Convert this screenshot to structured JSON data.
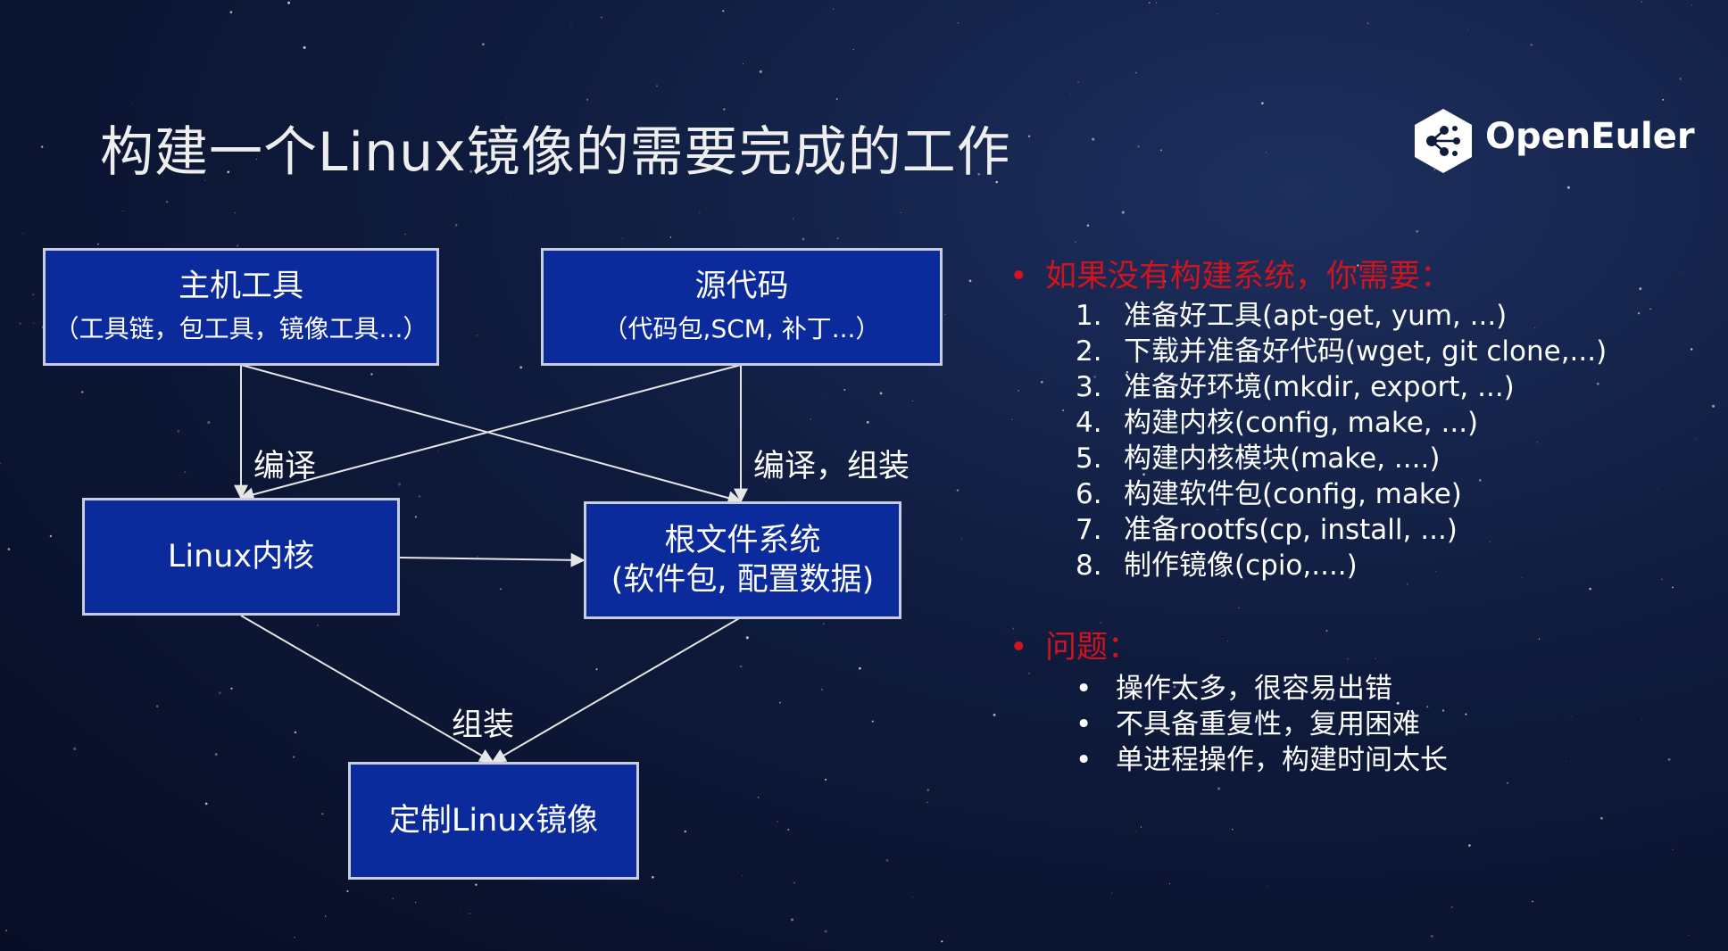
{
  "title": "构建一个Linux镜像的需要完成的工作",
  "logo": {
    "icon": "openeuler-hexagon-icon",
    "text": "OpenEuler"
  },
  "diagram": {
    "nodes": {
      "host_tools": {
        "main": "主机工具",
        "sub": "（工具链，包工具，镜像工具...）"
      },
      "source_code": {
        "main": "源代码",
        "sub": "（代码包,SCM, 补丁...）"
      },
      "kernel": {
        "main": "Linux内核"
      },
      "rootfs": {
        "main": "根文件系统",
        "sub": "(软件包, 配置数据)"
      },
      "image": {
        "main": "定制Linux镜像"
      }
    },
    "labels": {
      "compile": "编译",
      "compile_assemble": "编译，组装",
      "assemble": "组装"
    }
  },
  "panel": {
    "no_build_system": {
      "heading": "如果没有构建系统，你需要：",
      "steps": [
        {
          "num": "1.",
          "text": "准备好工具(apt-get, yum, ...)"
        },
        {
          "num": "2.",
          "text": "下载并准备好代码(wget, git clone,...)"
        },
        {
          "num": "3.",
          "text": "准备好环境(mkdir, export, ...)"
        },
        {
          "num": "4.",
          "text": "构建内核(config, make, ...)"
        },
        {
          "num": "5.",
          "text": "构建内核模块(make, ....)"
        },
        {
          "num": "6.",
          "text": "构建软件包(config, make)"
        },
        {
          "num": "7.",
          "text": "准备rootfs(cp, install, ...)"
        },
        {
          "num": "8.",
          "text": "制作镜像(cpio,....)"
        }
      ]
    },
    "problems": {
      "heading": "问题：",
      "items": [
        "操作太多，很容易出错",
        "不具备重复性，复用困难",
        "单进程操作，构建时间太长"
      ]
    }
  },
  "colors": {
    "background": "#0f1b3d",
    "box_fill": "#0b2a9c",
    "box_border": "#c8cde2",
    "heading_red": "#d0141e",
    "text": "#ffffff"
  }
}
